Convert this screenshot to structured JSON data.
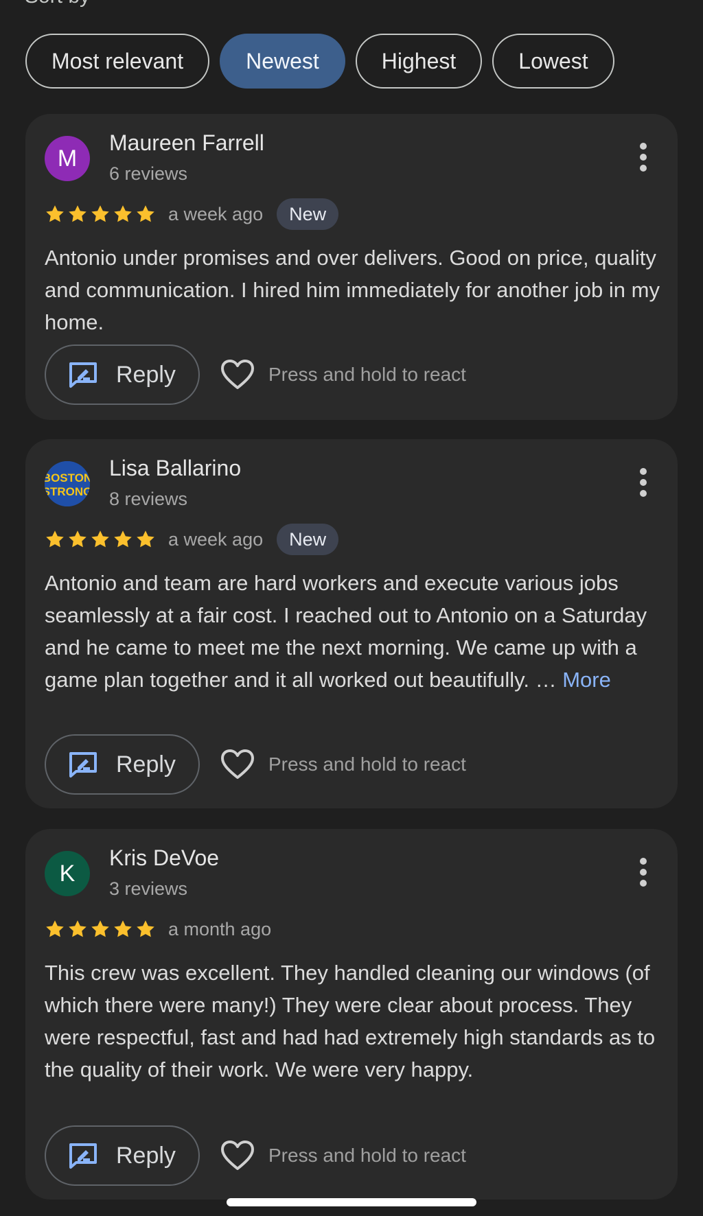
{
  "sort": {
    "label": "Sort by",
    "chips": [
      "Most relevant",
      "Newest",
      "Highest",
      "Lowest"
    ],
    "selected": "Newest"
  },
  "reviews": [
    {
      "name": "Maureen Farrell",
      "review_count": "6 reviews",
      "avatar_letter": "M",
      "avatar_color": "#8e2bb5",
      "rating": 5,
      "when": "a week ago",
      "badge": "New",
      "text": "Antonio under promises and over delivers. Good on price, quality and communication. I hired him immediately for another job in my home.",
      "more": "",
      "reply_label": "Reply",
      "react_label": "Press and hold to react"
    },
    {
      "name": "Lisa Ballarino",
      "review_count": "8 reviews",
      "avatar_logo_text": "BOSTON STRONG",
      "rating": 5,
      "when": "a week ago",
      "badge": "New",
      "text": "Antonio and team are hard workers and execute various jobs seamlessly at a fair cost. I reached out to Antonio on a Saturday and he came to meet me the next morning. We came up with a game plan together and it all worked out beautifully. … ",
      "more": "More",
      "reply_label": "Reply",
      "react_label": "Press and hold to react"
    },
    {
      "name": "Kris DeVoe",
      "review_count": "3 reviews",
      "avatar_letter": "K",
      "avatar_color": "#0c5a43",
      "rating": 5,
      "when": "a month ago",
      "badge": "",
      "text": "This crew was excellent. They handled cleaning our windows (of which there were many!) They were clear about process. They were respectful, fast and had had extremely high standards as to the quality of their work. We were very happy.",
      "more": "",
      "reply_label": "Reply",
      "react_label": "Press and hold to react"
    }
  ],
  "colors": {
    "background": "#1f1f1f",
    "card": "#2a2a2a",
    "selected_chip": "#3d5f8c",
    "star": "#fbc02d",
    "link": "#8ab4f8",
    "reply_icon": "#8ab4f8"
  },
  "icons": {
    "star": "star-icon",
    "menu": "more-vert-icon",
    "reply": "reply-icon",
    "react": "heart-icon"
  }
}
